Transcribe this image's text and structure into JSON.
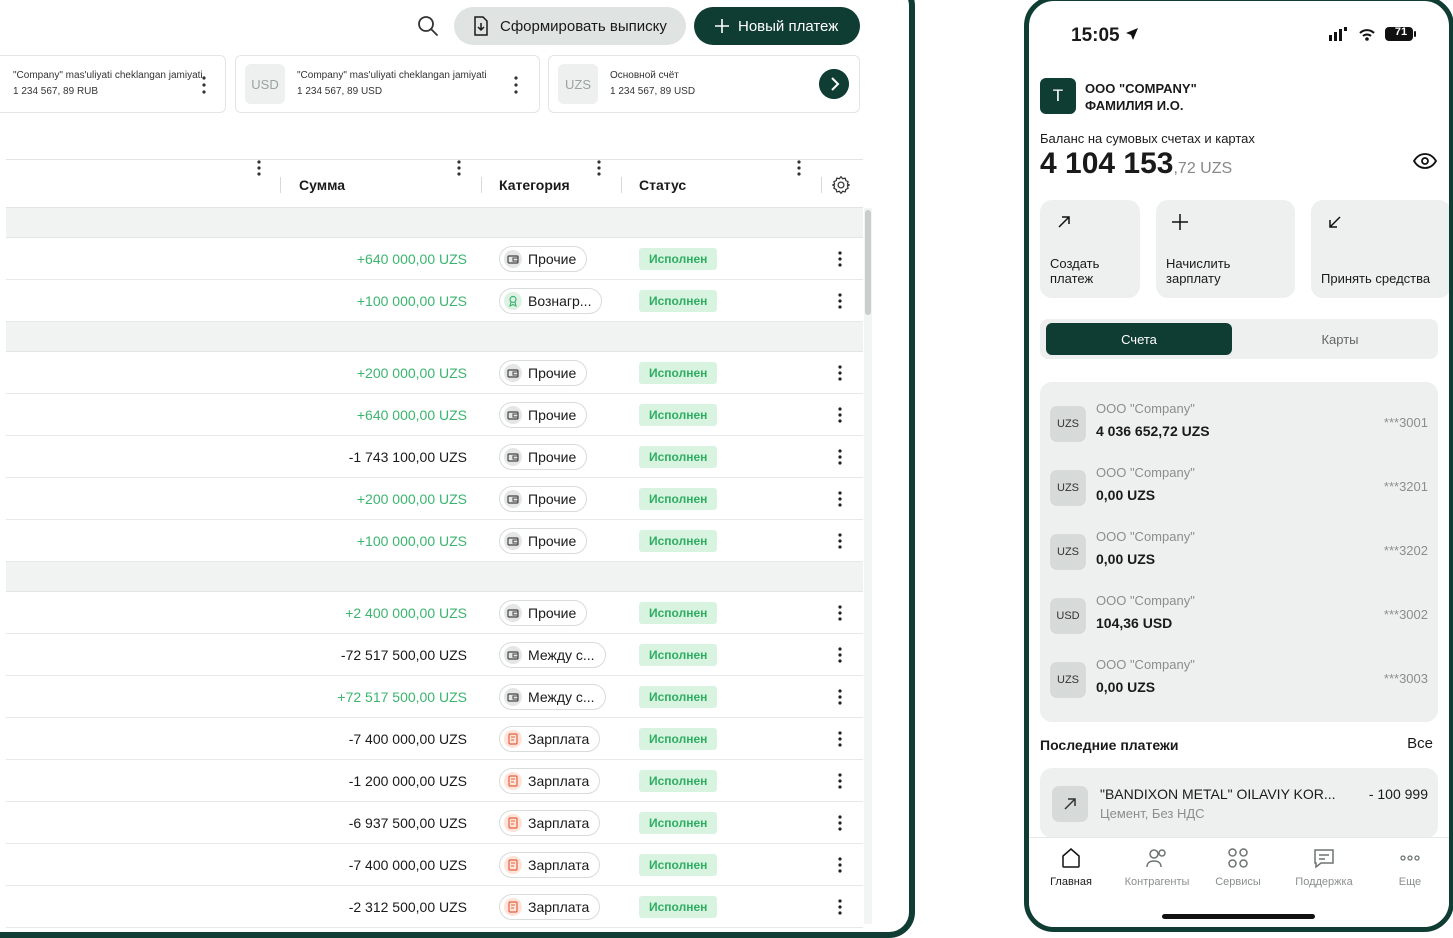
{
  "tablet": {
    "toolbar": {
      "statement_label": "Сформировать выписку",
      "new_payment_label": "Новый платеж"
    },
    "accounts": [
      {
        "badge": "",
        "name": "\"Company\" mas'uliyati cheklangan jamiyati",
        "amount": "1 234 567, 89 RUB"
      },
      {
        "badge": "USD",
        "name": "\"Company\" mas'uliyati cheklangan jamiyati",
        "amount": "1 234 567, 89 USD"
      },
      {
        "badge": "UZS",
        "name": "Основной счёт",
        "amount": "1 234 567, 89 USD"
      }
    ],
    "columns": {
      "amount": "Сумма",
      "category": "Категория",
      "status": "Статус"
    },
    "rows": [
      {
        "amount": "+640 000,00 UZS",
        "category": "Прочие",
        "status": "Исполнен"
      },
      {
        "amount": "+100 000,00 UZS",
        "category": "Вознагр...",
        "status": "Исполнен"
      },
      {
        "amount": "+200 000,00 UZS",
        "category": "Прочие",
        "status": "Исполнен"
      },
      {
        "amount": "+640 000,00 UZS",
        "category": "Прочие",
        "status": "Исполнен"
      },
      {
        "amount": "-1 743 100,00 UZS",
        "category": "Прочие",
        "status": "Исполнен"
      },
      {
        "amount": "+200 000,00 UZS",
        "category": "Прочие",
        "status": "Исполнен"
      },
      {
        "amount": "+100 000,00 UZS",
        "category": "Прочие",
        "status": "Исполнен"
      },
      {
        "amount": "+2 400 000,00 UZS",
        "category": "Прочие",
        "status": "Исполнен"
      },
      {
        "amount": "-72 517 500,00 UZS",
        "category": "Между с...",
        "status": "Исполнен"
      },
      {
        "amount": "+72 517 500,00 UZS",
        "category": "Между с...",
        "status": "Исполнен"
      },
      {
        "amount": "-7 400 000,00 UZS",
        "category": "Зарплата",
        "status": "Исполнен"
      },
      {
        "amount": "-1 200 000,00 UZS",
        "category": "Зарплата",
        "status": "Исполнен"
      },
      {
        "amount": "-6 937 500,00 UZS",
        "category": "Зарплата",
        "status": "Исполнен"
      },
      {
        "amount": "-7 400 000,00 UZS",
        "category": "Зарплата",
        "status": "Исполнен"
      },
      {
        "amount": "-2 312 500,00 UZS",
        "category": "Зарплата",
        "status": "Исполнен"
      }
    ]
  },
  "phone": {
    "status_bar": {
      "time": "15:05",
      "battery": "71"
    },
    "org": {
      "initial": "T",
      "line1": "ООО \"COMPANY\"",
      "line2": "ФАМИЛИЯ И.О."
    },
    "balance": {
      "label": "Баланс на сумовых счетах и картах",
      "whole": "4 104 153",
      "fraction": ",72 UZS"
    },
    "actions": {
      "create_payment": "Создать платеж",
      "salary": "Начислить зарплату",
      "receive": "Принять средства"
    },
    "segments": {
      "accounts": "Счета",
      "cards": "Карты"
    },
    "accounts": [
      {
        "badge": "UZS",
        "name": "ООО \"Company\"",
        "amount": "4 036 652,72  UZS",
        "number": "***3001"
      },
      {
        "badge": "UZS",
        "name": "ООО \"Company\"",
        "amount": "0,00  UZS",
        "number": "***3201"
      },
      {
        "badge": "UZS",
        "name": "ООО \"Company\"",
        "amount": "0,00  UZS",
        "number": "***3202"
      },
      {
        "badge": "USD",
        "name": "ООО \"Company\"",
        "amount": "104,36  USD",
        "number": "***3002"
      },
      {
        "badge": "UZS",
        "name": "ООО \"Company\"",
        "amount": "0,00  UZS",
        "number": "***3003"
      }
    ],
    "recent": {
      "title": "Последние платежи",
      "all": "Все",
      "payment": {
        "name": "\"BANDIXON METAL\" OILAVIY KOR...",
        "sub": "Цемент, Без НДС",
        "amount": "- 100 999"
      }
    },
    "tabs": [
      "Главная",
      "Контрагенты",
      "Сервисы",
      "Поддержка",
      "Еще"
    ]
  },
  "colors": {
    "brand": "#0f3d34",
    "positive": "#3bb56e",
    "status_bg": "#d8f3e0"
  }
}
